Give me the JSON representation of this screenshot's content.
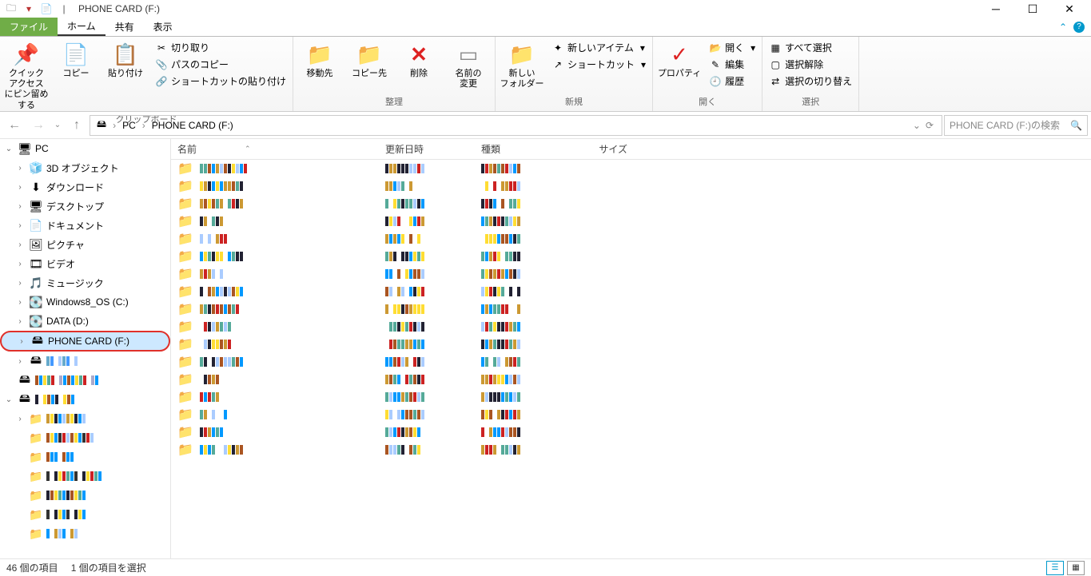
{
  "title": "PHONE CARD (F:)",
  "tabs": {
    "file": "ファイル",
    "home": "ホーム",
    "share": "共有",
    "view": "表示"
  },
  "ribbon": {
    "clipboard": {
      "label": "クリップボード",
      "pin": "クイック アクセス\nにピン留めする",
      "copy": "コピー",
      "paste": "貼り付け",
      "cut": "切り取り",
      "copypath": "パスのコピー",
      "pasteshortcut": "ショートカットの貼り付け"
    },
    "organize": {
      "label": "整理",
      "moveto": "移動先",
      "copyto": "コピー先",
      "delete": "削除",
      "rename": "名前の\n変更"
    },
    "new": {
      "label": "新規",
      "newfolder": "新しい\nフォルダー",
      "newitem": "新しいアイテム",
      "shortcut": "ショートカット"
    },
    "open": {
      "label": "開く",
      "properties": "プロパティ",
      "open": "開く",
      "edit": "編集",
      "history": "履歴"
    },
    "select": {
      "label": "選択",
      "all": "すべて選択",
      "none": "選択解除",
      "invert": "選択の切り替え"
    }
  },
  "breadcrumb": [
    "PC",
    "PHONE CARD (F:)"
  ],
  "search_placeholder": "PHONE CARD (F:)の検索",
  "tree": [
    {
      "d": 0,
      "exp": true,
      "icon": "pc",
      "label": "PC",
      "id": "pc"
    },
    {
      "d": 1,
      "exp": false,
      "icon": "obj",
      "label": "3D オブジェクト",
      "id": "3d"
    },
    {
      "d": 1,
      "exp": false,
      "icon": "dl",
      "label": "ダウンロード",
      "id": "downloads"
    },
    {
      "d": 1,
      "exp": false,
      "icon": "desk",
      "label": "デスクトップ",
      "id": "desktop"
    },
    {
      "d": 1,
      "exp": false,
      "icon": "doc",
      "label": "ドキュメント",
      "id": "documents"
    },
    {
      "d": 1,
      "exp": false,
      "icon": "pic",
      "label": "ピクチャ",
      "id": "pictures"
    },
    {
      "d": 1,
      "exp": false,
      "icon": "vid",
      "label": "ビデオ",
      "id": "videos"
    },
    {
      "d": 1,
      "exp": false,
      "icon": "mus",
      "label": "ミュージック",
      "id": "music"
    },
    {
      "d": 1,
      "exp": false,
      "icon": "drv",
      "label": "Windows8_OS (C:)",
      "id": "c"
    },
    {
      "d": 1,
      "exp": false,
      "icon": "drv",
      "label": "DATA (D:)",
      "id": "d"
    },
    {
      "d": 1,
      "exp": false,
      "icon": "usb",
      "label": "PHONE CARD (F:)",
      "id": "f",
      "selected": true
    },
    {
      "d": 1,
      "exp": false,
      "icon": "usb",
      "blur": [
        "#6ac",
        "#49f",
        "#fff",
        "#acf"
      ],
      "id": "g"
    },
    {
      "d": 0,
      "exp": null,
      "icon": "usb",
      "blur": [
        "#a52",
        "#09f",
        "#fd3",
        "#5a9",
        "#c22",
        "#fff",
        "#aac",
        "#09f"
      ],
      "id": "usb2"
    },
    {
      "d": 0,
      "exp": true,
      "icon": "usb",
      "blur": [
        "#223",
        "#fff",
        "#fd3",
        "#a52",
        "#09f"
      ],
      "id": "usb3"
    },
    {
      "d": 1,
      "exp": false,
      "icon": "fld",
      "blur": [
        "#c93",
        "#fd3",
        "#223",
        "#09f",
        "#acf"
      ],
      "id": "sub1"
    },
    {
      "d": 1,
      "exp": null,
      "icon": "fld",
      "blur": [
        "#a52",
        "#fd3",
        "#09f",
        "#333",
        "#c22",
        "#acf"
      ],
      "id": "sub2"
    },
    {
      "d": 1,
      "exp": null,
      "icon": "fld",
      "blur": [
        "#a52",
        "#09f",
        "#09f",
        "#fff"
      ],
      "id": "sub3"
    },
    {
      "d": 1,
      "exp": null,
      "icon": "fld",
      "blur": [
        "#333",
        "#fff",
        "#223",
        "#fd3",
        "#c22",
        "#5a9",
        "#09f"
      ],
      "id": "sub4"
    },
    {
      "d": 1,
      "exp": null,
      "icon": "fld",
      "blur": [
        "#223",
        "#a52",
        "#fd3",
        "#5a9",
        "#09f"
      ],
      "id": "sub5"
    },
    {
      "d": 1,
      "exp": null,
      "icon": "fld",
      "blur": [
        "#333",
        "#fff",
        "#223",
        "#fd3",
        "#09f"
      ],
      "id": "sub6"
    },
    {
      "d": 1,
      "exp": null,
      "icon": "fld",
      "blur": [
        "#09f",
        "#fff",
        "#c93",
        "#acf"
      ],
      "id": "sub7"
    }
  ],
  "columns": {
    "name": "名前",
    "date": "更新日時",
    "type": "種類",
    "size": "サイズ"
  },
  "items_count": 17,
  "status": {
    "items": "46 個の項目",
    "selected": "1 個の項目を選択"
  }
}
